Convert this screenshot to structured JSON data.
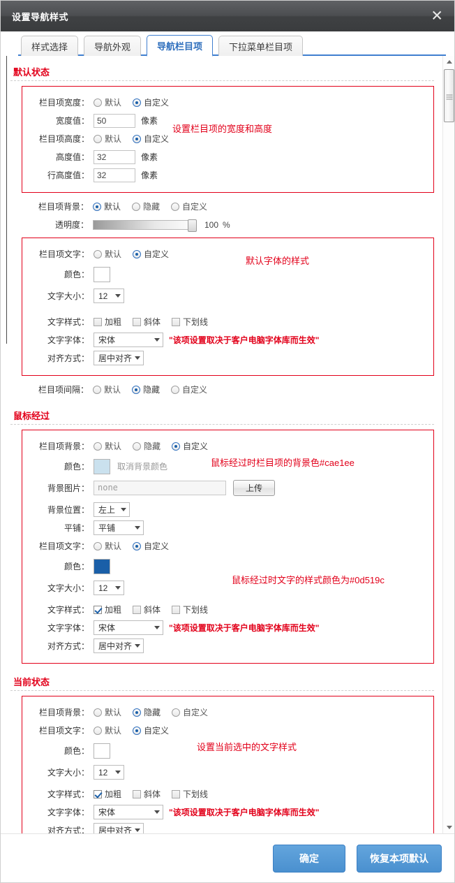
{
  "dialog": {
    "title": "设置导航样式",
    "close_icon": "close-icon"
  },
  "tabs": [
    {
      "label": "样式选择",
      "active": false
    },
    {
      "label": "导航外观",
      "active": false
    },
    {
      "label": "导航栏目项",
      "active": true
    },
    {
      "label": "下拉菜单栏目项",
      "active": false
    }
  ],
  "common": {
    "default": "默认",
    "custom": "自定义",
    "hidden": "隐藏",
    "pixel": "像素",
    "color_label": "颜色：",
    "font_size_label": "文字大小：",
    "font_style_label": "文字样式：",
    "font_family_label": "文字字体：",
    "align_label": "对齐方式：",
    "bold": "加粗",
    "italic": "斜体",
    "underline": "下划线",
    "font_note": "\"该项设置取决于客户电脑字体库而生效\"",
    "font_value": "宋体",
    "size_value": "12",
    "align_value": "居中对齐"
  },
  "sections": {
    "default_state": {
      "title": "默认状态",
      "width_label": "栏目项宽度：",
      "width_value_label": "宽度值：",
      "width_value": "50",
      "height_label": "栏目项高度：",
      "height_value_label": "高度值：",
      "height_value": "32",
      "lineheight_value_label": "行高度值：",
      "lineheight_value": "32",
      "bg_label": "栏目项背景：",
      "opacity_label": "透明度：",
      "opacity_value": "100",
      "opacity_unit": "%",
      "text_label": "栏目项文字：",
      "text_color": "#ffffff",
      "spacing_label": "栏目项间隔：",
      "annot_size": "设置栏目项的宽度和高度",
      "annot_font": "默认字体的样式"
    },
    "hover_state": {
      "title": "鼠标经过",
      "bg_label": "栏目项背景：",
      "bg_color": "#cae1ee",
      "cancel_bg_color": "取消背景颜色",
      "bg_image_label": "背景图片：",
      "bg_image_value": "none",
      "upload_button": "上传",
      "bg_position_label": "背景位置：",
      "bg_position_value": "左上",
      "tile_label": "平铺：",
      "tile_value": "平铺",
      "text_label": "栏目项文字：",
      "text_color": "#1a5fa8",
      "annot_bg": "鼠标经过时栏目项的背景色#cae1ee",
      "annot_text": "鼠标经过时文字的样式颜色为#0d519c"
    },
    "current_state": {
      "title": "当前状态",
      "bg_label": "栏目项背景：",
      "text_label": "栏目项文字：",
      "text_color": "#ffffff",
      "annot_text": "设置当前选中的文字样式"
    }
  },
  "footer": {
    "confirm": "确定",
    "restore": "恢复本项默认"
  }
}
